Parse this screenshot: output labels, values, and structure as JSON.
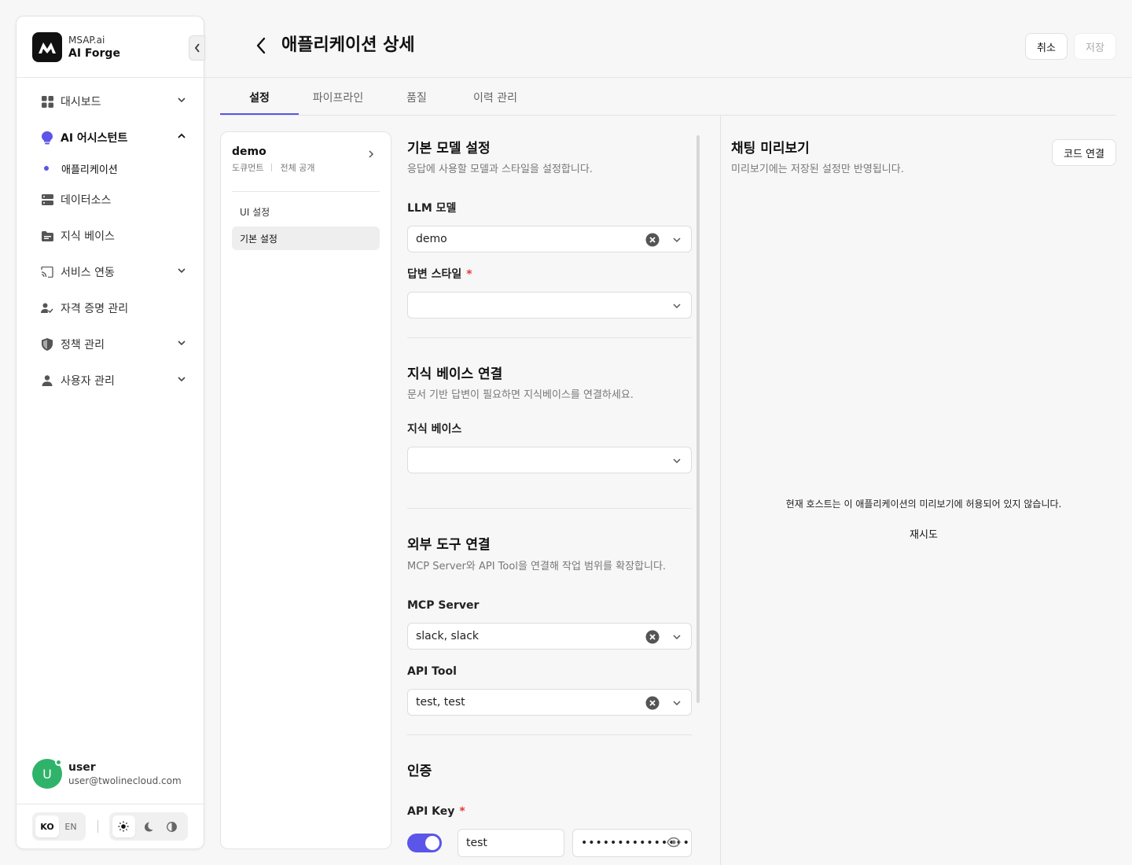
{
  "brand": {
    "org": "MSAP.ai",
    "name": "AI Forge"
  },
  "sidebar": {
    "items": [
      {
        "label": "대시보드"
      },
      {
        "label": "AI 어시스턴트"
      },
      {
        "label": "애플리케이션"
      },
      {
        "label": "데이터소스"
      },
      {
        "label": "지식 베이스"
      },
      {
        "label": "서비스 연동"
      },
      {
        "label": "자격 증명 관리"
      },
      {
        "label": "정책 관리"
      },
      {
        "label": "사용자 관리"
      }
    ]
  },
  "user": {
    "initial": "U",
    "name": "user",
    "email": "user@twolinecloud.com"
  },
  "language": {
    "options": [
      "KO",
      "EN"
    ],
    "selected": "KO"
  },
  "header": {
    "title": "애플리케이션 상세",
    "cancel_label": "취소",
    "save_label": "저장"
  },
  "tabs": [
    {
      "label": "설정"
    },
    {
      "label": "파이프라인"
    },
    {
      "label": "품질"
    },
    {
      "label": "이력 관리"
    }
  ],
  "settings_nav": {
    "doc_name": "demo",
    "doc_type": "도큐먼트",
    "visibility": "전체 공개",
    "items": [
      {
        "label": "UI 설정"
      },
      {
        "label": "기본 설정"
      }
    ]
  },
  "form": {
    "model_section": {
      "title": "기본 모델 설정",
      "desc": "응답에 사용할 모델과 스타일을 설정합니다."
    },
    "llm_model": {
      "label": "LLM 모델",
      "value": "demo"
    },
    "answer_style": {
      "label": "답변 스타일",
      "required": "*",
      "value": ""
    },
    "kb_section": {
      "title": "지식 베이스 연결",
      "desc": "문서 기반 답변이 필요하면 지식베이스를 연결하세요."
    },
    "knowledge_base": {
      "label": "지식 베이스",
      "value": ""
    },
    "tools_section": {
      "title": "외부 도구 연결",
      "desc": "MCP Server와 API Tool을 연결해 작업 범위를 확장합니다."
    },
    "mcp_server": {
      "label": "MCP Server",
      "value": "slack, slack"
    },
    "api_tool": {
      "label": "API Tool",
      "value": "test, test"
    },
    "auth_section": {
      "title": "인증"
    },
    "api_key": {
      "label": "API Key",
      "required": "*",
      "name_value": "test",
      "secret_value": "••••••••••••••••",
      "enabled": true
    }
  },
  "preview": {
    "title": "채팅 미리보기",
    "desc": "미리보기에는 저장된 설정만 반영됩니다.",
    "code_button": "코드 연결",
    "message": "현재 호스트는 이 애플리케이션의 미리보기에 허용되어 있지 않습니다.",
    "retry": "재시도"
  },
  "colors": {
    "accent": "#5b55e8",
    "avatar": "#2fb36a",
    "required": "#e53935"
  }
}
